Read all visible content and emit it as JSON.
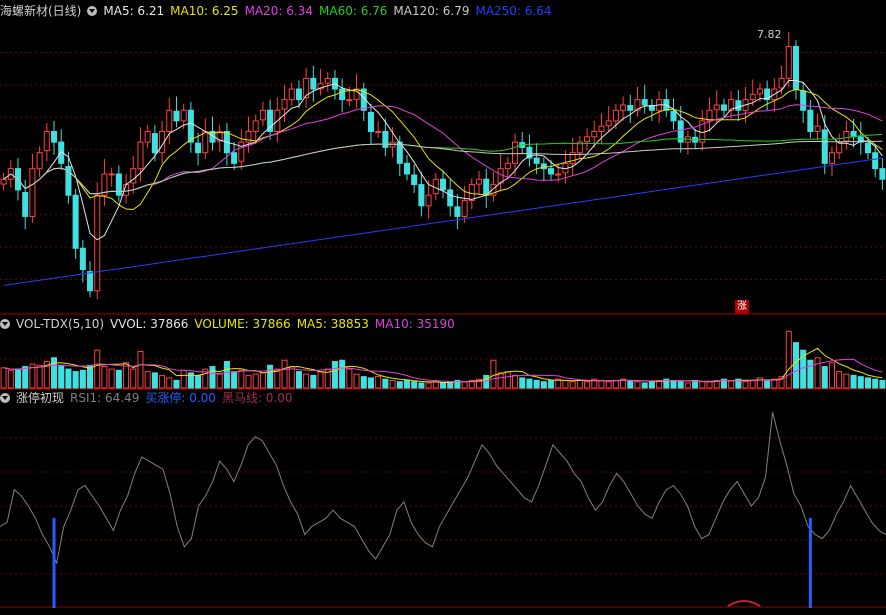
{
  "main": {
    "title": "海螺新材(日线)",
    "ma": [
      {
        "label": "MA5: 6.21",
        "color": "#e6e6e6"
      },
      {
        "label": "MA10: 6.25",
        "color": "#e6e600"
      },
      {
        "label": "MA20: 6.34",
        "color": "#e040e0"
      },
      {
        "label": "MA60: 6.76",
        "color": "#20d020"
      },
      {
        "label": "MA120: 6.79",
        "color": "#c8c8c8"
      },
      {
        "label": "MA250: 6.64",
        "color": "#2040ff"
      }
    ],
    "high_label": "7.82",
    "zt_badge": "涨"
  },
  "vol": {
    "title": "VOL-TDX(5,10)",
    "items": [
      {
        "label": "VVOL: 37866",
        "color": "#e6e6e6"
      },
      {
        "label": "VOLUME: 37866",
        "color": "#e6e600"
      },
      {
        "label": "MA5: 38853",
        "color": "#e6e600"
      },
      {
        "label": "MA10: 35190",
        "color": "#e040e0"
      }
    ]
  },
  "ind": {
    "title": "涨停初现",
    "items": [
      {
        "label": "RSI1: 64.49",
        "color": "#808080"
      },
      {
        "label": "买涨停: 0.00",
        "color": "#2060ff"
      },
      {
        "label": "黑马线: 0.00",
        "color": "#a03050"
      }
    ]
  },
  "chart_data": [
    {
      "type": "candlestick",
      "title": "海螺新材(日线)",
      "note": "Daily K-line with moving averages; values approximate, read from the chart",
      "close": [
        6.45,
        6.55,
        6.35,
        6.1,
        6.55,
        6.7,
        6.9,
        6.8,
        6.6,
        6.3,
        5.8,
        5.6,
        5.4,
        6.3,
        6.5,
        6.5,
        6.3,
        6.4,
        6.55,
        6.8,
        6.9,
        6.7,
        6.9,
        7.1,
        7.0,
        7.1,
        6.8,
        6.7,
        6.9,
        6.8,
        6.9,
        6.7,
        6.6,
        6.8,
        6.9,
        7.0,
        7.1,
        6.9,
        7.1,
        7.2,
        7.3,
        7.2,
        7.4,
        7.3,
        7.35,
        7.4,
        7.3,
        7.2,
        7.2,
        7.3,
        7.1,
        6.9,
        6.9,
        6.75,
        6.8,
        6.6,
        6.5,
        6.4,
        6.2,
        6.3,
        6.45,
        6.35,
        6.2,
        6.1,
        6.25,
        6.4,
        6.45,
        6.3,
        6.4,
        6.55,
        6.6,
        6.8,
        6.75,
        6.65,
        6.6,
        6.55,
        6.5,
        6.5,
        6.6,
        6.7,
        6.8,
        6.85,
        6.9,
        6.95,
        7.0,
        7.1,
        7.15,
        7.1,
        7.2,
        7.15,
        7.1,
        7.2,
        7.1,
        7.0,
        6.8,
        6.85,
        6.8,
        7.0,
        7.1,
        7.15,
        7.1,
        7.2,
        7.1,
        7.2,
        7.25,
        7.3,
        7.2,
        7.3,
        7.4,
        7.7,
        7.3,
        7.1,
        6.9,
        6.95,
        6.6,
        6.7,
        6.8,
        6.9,
        6.85,
        6.8,
        6.7,
        6.55,
        6.45
      ],
      "high": 7.82,
      "ma_values": {
        "MA5": 6.21,
        "MA10": 6.25,
        "MA20": 6.34,
        "MA60": 6.76,
        "MA120": 6.79,
        "MA250": 6.64
      },
      "series_colors": {
        "up": "#ff4040",
        "down": "#40e0e0"
      }
    },
    {
      "type": "bar",
      "title": "VOL-TDX(5,10)",
      "values_last": {
        "VVOL": 37866,
        "VOLUME": 37866,
        "MA5": 38853,
        "MA10": 35190
      },
      "volume": [
        32,
        28,
        30,
        34,
        38,
        36,
        42,
        48,
        36,
        30,
        26,
        28,
        36,
        60,
        34,
        30,
        28,
        40,
        30,
        58,
        26,
        24,
        20,
        16,
        12,
        28,
        24,
        20,
        30,
        34,
        22,
        42,
        26,
        28,
        20,
        22,
        24,
        36,
        30,
        44,
        34,
        26,
        22,
        20,
        26,
        30,
        42,
        44,
        30,
        22,
        18,
        16,
        18,
        14,
        12,
        10,
        12,
        10,
        8,
        8,
        10,
        8,
        10,
        12,
        10,
        12,
        14,
        20,
        44,
        24,
        26,
        20,
        16,
        14,
        12,
        10,
        12,
        14,
        12,
        10,
        12,
        10,
        14,
        12,
        10,
        12,
        14,
        12,
        10,
        8,
        10,
        12,
        14,
        12,
        10,
        8,
        12,
        10,
        10,
        12,
        14,
        12,
        14,
        10,
        12,
        16,
        12,
        14,
        18,
        90,
        72,
        60,
        44,
        48,
        34,
        40,
        26,
        22,
        20,
        18,
        16,
        14,
        12
      ]
    },
    {
      "type": "line",
      "title": "涨停初现",
      "values_last": {
        "RSI1": 64.49,
        "买涨停": 0.0,
        "黑马线": 0.0
      },
      "rsi": [
        40,
        42,
        58,
        55,
        50,
        44,
        36,
        30,
        22,
        40,
        48,
        58,
        60,
        55,
        50,
        44,
        38,
        48,
        55,
        66,
        74,
        72,
        70,
        68,
        56,
        40,
        30,
        34,
        50,
        55,
        62,
        72,
        68,
        62,
        70,
        80,
        84,
        82,
        76,
        70,
        60,
        52,
        46,
        36,
        40,
        42,
        44,
        48,
        44,
        42,
        40,
        34,
        28,
        24,
        30,
        36,
        48,
        52,
        42,
        36,
        32,
        30,
        40,
        46,
        52,
        58,
        64,
        72,
        80,
        76,
        70,
        66,
        62,
        58,
        54,
        52,
        60,
        70,
        80,
        76,
        72,
        66,
        62,
        54,
        48,
        52,
        60,
        66,
        62,
        56,
        50,
        46,
        44,
        52,
        58,
        60,
        56,
        50,
        40,
        34,
        36,
        44,
        52,
        58,
        62,
        56,
        50,
        54,
        64,
        96,
        82,
        70,
        56,
        50,
        40,
        36,
        34,
        38,
        46,
        52,
        60,
        54,
        48,
        42,
        38,
        36
      ],
      "buy_limit_up_bars": [
        {
          "index": 7,
          "value": 1
        },
        {
          "index": 112,
          "value": 1
        }
      ]
    }
  ]
}
